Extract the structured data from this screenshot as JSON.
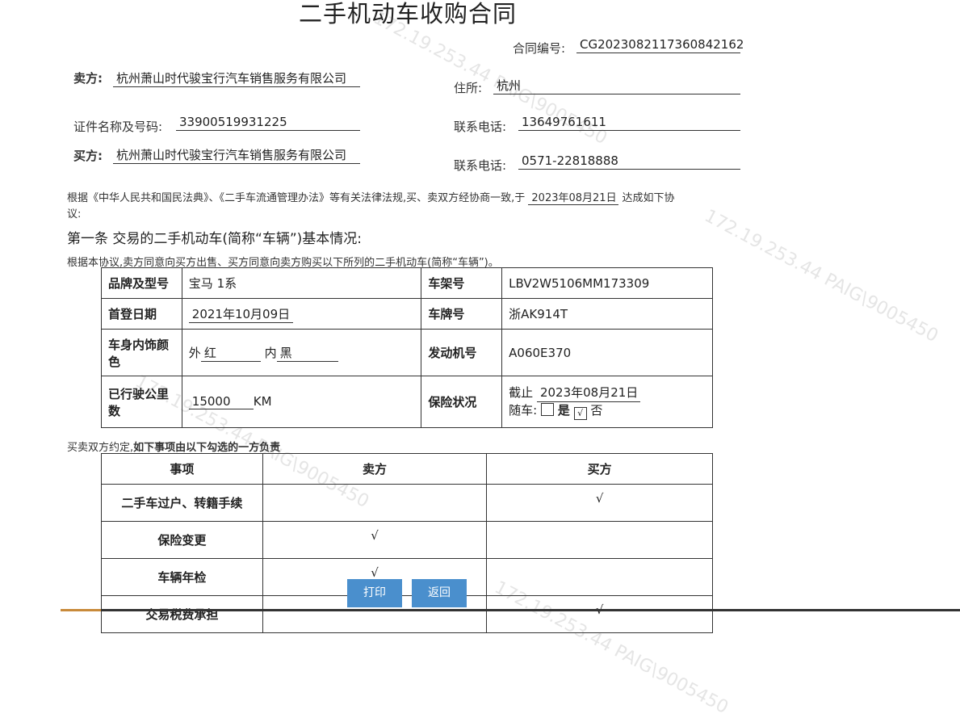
{
  "title": "二手机动车收购合同",
  "contract_no": {
    "label": "合同编号:",
    "value": "CG2023082117360842162"
  },
  "seller": {
    "label": "卖方:",
    "name": "杭州萧山时代骏宝行汽车销售服务有限公司",
    "address_label": "住所:",
    "address": "杭州",
    "id_label": "证件名称及号码:",
    "id_value": "33900519931225",
    "phone_label": "联系电话:",
    "phone": "13649761611"
  },
  "buyer": {
    "label": "买方:",
    "name": "杭州萧山时代骏宝行汽车销售服务有限公司",
    "phone_label": "联系电话:",
    "phone": "0571-22818888"
  },
  "intro": {
    "text_before": "根据《中华人民共和国民法典》、《二手车流通管理办法》等有关法律法规,买、卖双方经协商一致,于",
    "date": "2023年08月21日",
    "text_after": "达成如下协",
    "text_line2": "议:"
  },
  "article1": {
    "heading": "第一条 交易的二手机动车(简称“车辆”)基本情况:",
    "desc": "根据本协议,卖方同意向买方出售、买方同意向卖方购买以下所列的二手机动车(简称“车辆”)。"
  },
  "vehicle": {
    "brand_label": "品牌及型号",
    "brand": "宝马 1系",
    "vin_label": "车架号",
    "vin": "LBV2W5106MM173309",
    "first_reg_label": "首登日期",
    "first_reg": "2021年10月09日",
    "plate_label": "车牌号",
    "plate": "浙AK914T",
    "color_label": "车身内饰颜色",
    "exterior_prefix": "外",
    "exterior": "红",
    "interior_prefix": "内",
    "interior": "黑",
    "engine_label": "发动机号",
    "engine": "A060E370",
    "mileage_label": "已行驶公里数",
    "mileage": "15000",
    "mileage_unit": "KM",
    "insurance_label": "保险状况",
    "insurance_prefix": "截止",
    "insurance_until": "2023年08月21日",
    "with_car_label": "随车:",
    "yes_label": "是",
    "no_label": "否",
    "check_mark": "√",
    "insurance_with_car": false
  },
  "duties": {
    "intro_normal": "买卖双方约定,",
    "intro_bold": "如下事项由以下勾选的一方负责",
    "headers": [
      "事项",
      "卖方",
      "买方"
    ],
    "rows": [
      {
        "item": "二手车过户、转籍手续",
        "seller": "",
        "buyer": "√"
      },
      {
        "item": "保险变更",
        "seller": "√",
        "buyer": ""
      },
      {
        "item": "车辆年检",
        "seller": "√",
        "buyer": ""
      },
      {
        "item": "交易税费承担",
        "seller": "",
        "buyer": "√"
      }
    ]
  },
  "buttons": {
    "print": "打印",
    "back": "返回"
  },
  "watermark": "172.19.253.44  PAIG\\9005450",
  "colors": {
    "button": "#4a8fcd",
    "border": "#333333",
    "accent": "#c88a3a"
  }
}
